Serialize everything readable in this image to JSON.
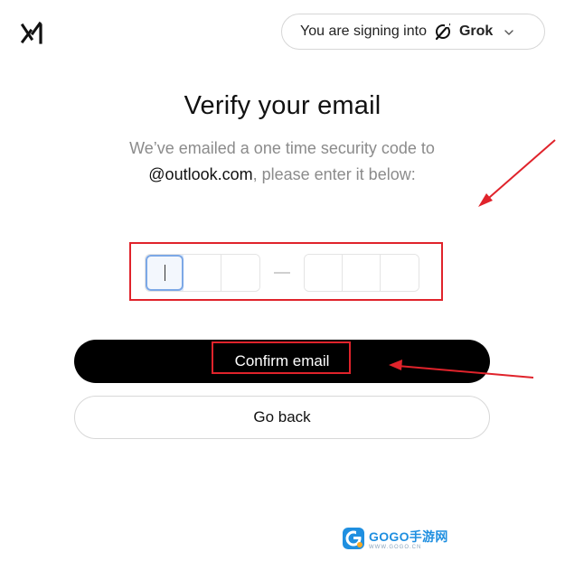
{
  "header": {
    "logo_icon": "xai-logo-icon",
    "signin_prefix": "You are signing into",
    "app_icon": "grok-icon",
    "app_name": "Grok",
    "dropdown_icon": "chevron-down-icon"
  },
  "main": {
    "title": "Verify your email",
    "description_before": "We’ve emailed a one time security code to",
    "email": "@outlook.com",
    "description_after": ", please enter it below:",
    "code_cells": [
      "",
      "",
      "",
      "",
      "",
      ""
    ],
    "separator": "—",
    "confirm_label": "Confirm email",
    "back_label": "Go back"
  },
  "annotations": {
    "color": "#e0232b"
  },
  "watermark": {
    "main": "GOGO手游网",
    "url": "WWW.GOGO.CN"
  },
  "colors": {
    "accent": "#000000",
    "focus_ring": "#7ca8e6",
    "muted_text": "#8b8b8b"
  }
}
